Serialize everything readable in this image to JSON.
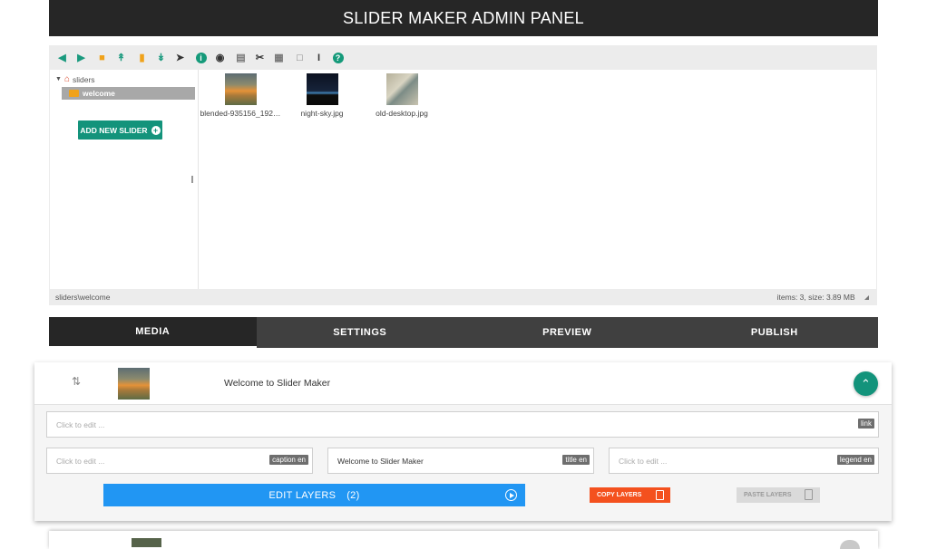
{
  "header": {
    "title": "SLIDER MAKER ADMIN PANEL"
  },
  "file_manager": {
    "toolbar": [
      {
        "name": "back-icon",
        "glyph": "🡄"
      },
      {
        "name": "forward-icon",
        "glyph": "🡆"
      },
      {
        "name": "new-folder-icon",
        "glyph": "📁"
      },
      {
        "name": "upload-icon",
        "glyph": "⤒"
      },
      {
        "name": "new-file-icon",
        "glyph": "▮"
      },
      {
        "name": "download-icon",
        "glyph": "⤓"
      },
      {
        "name": "select-icon",
        "glyph": "➤"
      },
      {
        "name": "info-icon",
        "glyph": "i"
      },
      {
        "name": "view-icon",
        "glyph": "◉"
      },
      {
        "name": "copy-icon",
        "glyph": "▤"
      },
      {
        "name": "cut-icon",
        "glyph": "✂"
      },
      {
        "name": "paste-icon",
        "glyph": "📋"
      },
      {
        "name": "delete-icon",
        "glyph": "🗑"
      },
      {
        "name": "rename-icon",
        "glyph": "I"
      },
      {
        "name": "help-icon",
        "glyph": "?"
      }
    ],
    "tree": {
      "root_label": "sliders",
      "selected_label": "welcome"
    },
    "add_slider_label": "ADD NEW SLIDER",
    "files": [
      {
        "name": "blended-935156_192…"
      },
      {
        "name": "night-sky.jpg"
      },
      {
        "name": "old-desktop.jpg"
      }
    ],
    "status": {
      "path": "sliders\\welcome",
      "info": "items: 3, size: 3.89 MB"
    }
  },
  "tabs": [
    {
      "label": "MEDIA",
      "active": true
    },
    {
      "label": "SETTINGS",
      "active": false
    },
    {
      "label": "PREVIEW",
      "active": false
    },
    {
      "label": "PUBLISH",
      "active": false
    }
  ],
  "slide": {
    "title": "Welcome to Slider Maker",
    "link": {
      "placeholder": "Click to edit ...",
      "tag": "link"
    },
    "caption": {
      "placeholder": "Click to edit ...",
      "tag": "caption en"
    },
    "title_field": {
      "value": "Welcome to Slider Maker",
      "tag": "title en"
    },
    "legend": {
      "placeholder": "Click to edit ...",
      "tag": "legend en"
    },
    "edit_layers_label": "EDIT LAYERS",
    "edit_layers_count": "(2)",
    "copy_layers_label": "COPY LAYERS",
    "paste_layers_label": "PASTE LAYERS"
  }
}
